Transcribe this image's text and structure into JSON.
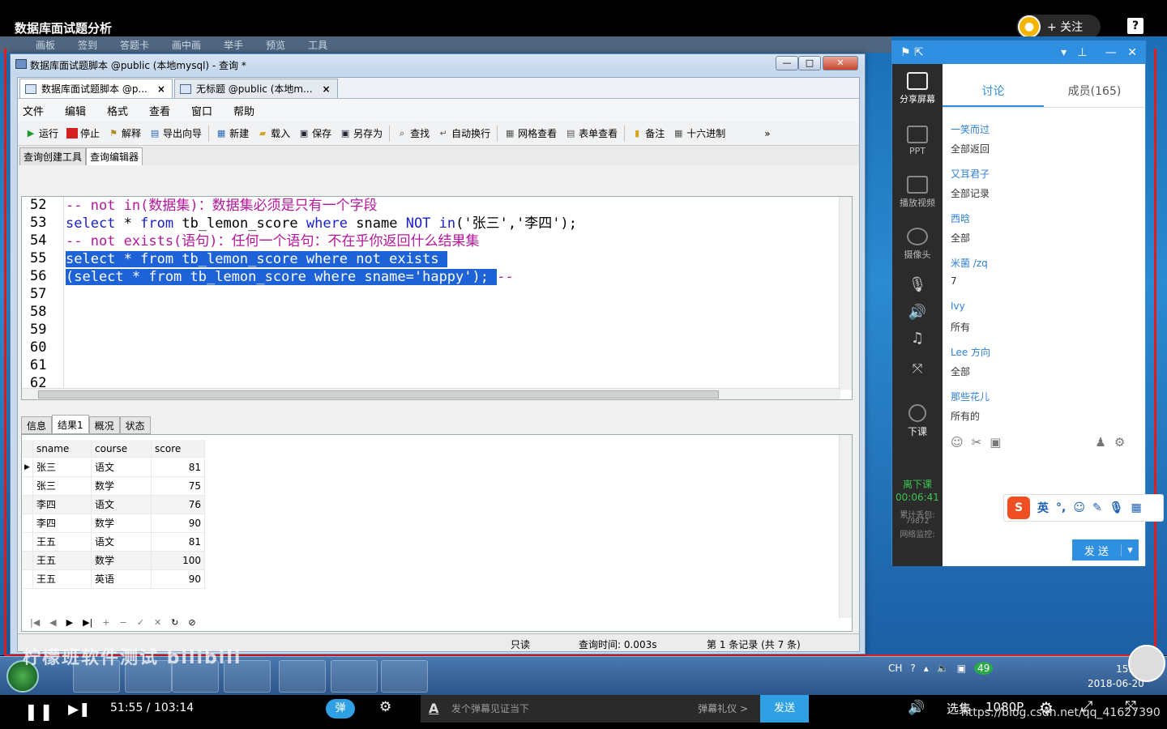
{
  "video": {
    "title": "数据库面试题分析",
    "follow_label": "+ 关注",
    "question_icon": "?",
    "watermark": "柠檬班软件测试 bilibili",
    "url": "https://blog.csdn.net/qq_41627390"
  },
  "behind_bar": [
    "画板",
    "签到",
    "答题卡",
    "画中画",
    "举手",
    "预览",
    "工具"
  ],
  "window": {
    "title": "数据库面试题脚本 @public (本地mysql) - 查询 *",
    "min": "—",
    "max": "□",
    "close": "✕",
    "doc_tabs": [
      {
        "label": "数据库面试题脚本 @p...",
        "close": "×"
      },
      {
        "label": "无标题 @public (本地m...",
        "close": "×"
      }
    ],
    "menu": [
      "文件",
      "编辑",
      "格式",
      "查看",
      "窗口",
      "帮助"
    ],
    "toolbar": {
      "run": "运行",
      "stop": "停止",
      "explain": "解释",
      "export": "导出向导",
      "new": "新建",
      "load": "载入",
      "save": "保存",
      "save_as": "另存为",
      "find": "查找",
      "wrap": "自动换行",
      "grid_view": "网格查看",
      "form_view": "表单查看",
      "note": "备注",
      "hex": "十六进制",
      "more": "»"
    },
    "sub_tabs": [
      "查询创建工具",
      "查询编辑器"
    ],
    "editor": {
      "line_numbers": [
        "52",
        "53",
        "54",
        "55",
        "56",
        "57",
        "58",
        "59",
        "60",
        "61",
        "62"
      ],
      "line52": "-- not in(数据集)：数据集必须是只有一个字段",
      "line53": {
        "p1": "select",
        "p2": " * ",
        "p3": "from",
        "p4": " tb_lemon_score ",
        "p5": "where",
        "p6": " sname ",
        "p7": "NOT in",
        "p8": "('张三','李四');"
      },
      "line54": "-- not exists(语句)：任何一个语句：不在乎你返回什么结果集",
      "line55": "select * from tb_lemon_score where not exists ",
      "line56a": "(select * from tb_lemon_score where sname='happy'); ",
      "line56b": "--"
    },
    "result_tabs": [
      "信息",
      "结果1",
      "概况",
      "状态"
    ],
    "grid": {
      "columns": [
        "sname",
        "course",
        "score"
      ],
      "rows": [
        [
          "张三",
          "语文",
          "81"
        ],
        [
          "张三",
          "数学",
          "75"
        ],
        [
          "李四",
          "语文",
          "76"
        ],
        [
          "李四",
          "数学",
          "90"
        ],
        [
          "王五",
          "语文",
          "81"
        ],
        [
          "王五",
          "数学",
          "100"
        ],
        [
          "王五",
          "英语",
          "90"
        ]
      ]
    },
    "status": {
      "readonly": "只读",
      "query_time": "查询时间: 0.003s",
      "record": "第 1 条记录 (共 7 条)"
    }
  },
  "panel": {
    "side": {
      "share": "分享屏幕",
      "ppt": "PPT",
      "video": "播放视频",
      "camera": "摄像头",
      "end": "下课",
      "leave": "离下课",
      "timer": "00:06:41",
      "lost": "累计丢包:",
      "lost_val": "79872",
      "monitor": "网络监控:"
    },
    "tabs": [
      "讨论",
      "成员(165)"
    ],
    "messages": [
      {
        "user": "一笑而过",
        "text": "全部返回"
      },
      {
        "user": "又耳君子",
        "text": "全部记录"
      },
      {
        "user": "西晗",
        "text": "全部"
      },
      {
        "user": "米菌 /zq",
        "text": "7"
      },
      {
        "user": "Ivy",
        "text": "所有"
      },
      {
        "user": "Lee 方向",
        "text": "全部"
      },
      {
        "user": "那些花儿",
        "text": "所有的"
      }
    ],
    "send": "发 送",
    "ime": {
      "logo": "S",
      "mode": "英"
    }
  },
  "taskbar": {
    "lang": "CH",
    "badge": "49",
    "time": "15:53",
    "date": "2018-06-20"
  },
  "player": {
    "time": "51:55 / 103:14",
    "danmu": "弹",
    "placeholder": "发个弹幕见证当下",
    "etiquette": "弹幕礼仪 >",
    "send": "发送",
    "select": "选集",
    "quality": "1080P"
  }
}
